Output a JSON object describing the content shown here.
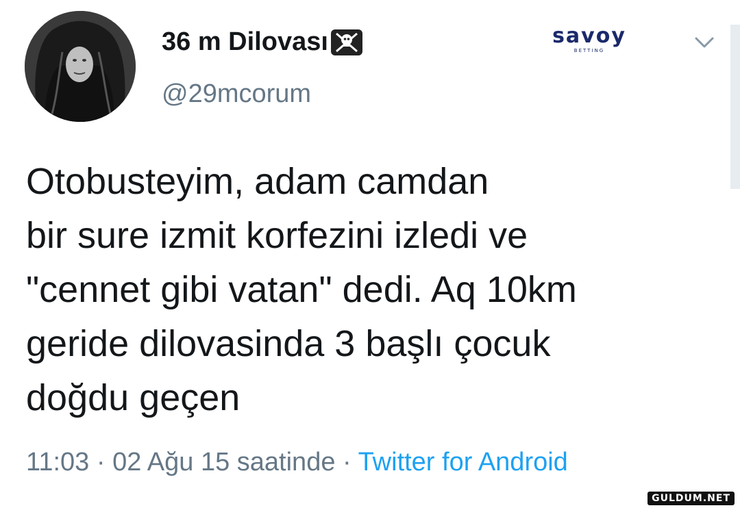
{
  "user": {
    "display_name": "36 m Dilovası",
    "handle": "@29mcorum",
    "badge_icon": "skull-crossbones-icon"
  },
  "brand": {
    "name": "savoy",
    "sub": "BETTING"
  },
  "tweet": {
    "lines": [
      "Otobusteyim, adam camdan",
      "bir sure izmit korfezini izledi ve",
      "\"cennet gibi vatan\" dedi. Aq 10km",
      "geride dilovasinda 3 başlı çocuk",
      "doğdu geçen"
    ]
  },
  "meta": {
    "time": "11:03",
    "sep1": " · ",
    "date": "02 Ağu 15 saatinde",
    "sep2": " · ",
    "source": "Twitter for Android"
  },
  "watermark": "GULDUM.NET",
  "colors": {
    "text": "#14171a",
    "secondary": "#657786",
    "link": "#1da1f2"
  }
}
